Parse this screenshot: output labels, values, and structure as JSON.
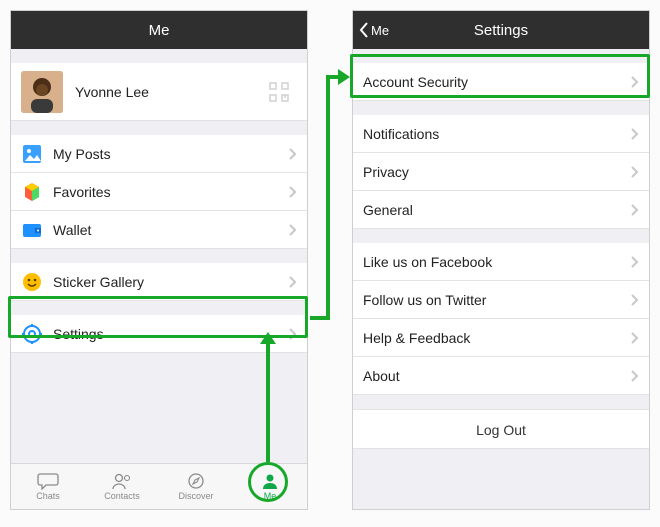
{
  "highlight_color": "#17a82a",
  "left": {
    "title": "Me",
    "profile": {
      "name": "Yvonne Lee"
    },
    "group1": [
      {
        "icon": "posts-icon",
        "label": "My Posts"
      },
      {
        "icon": "favorites-icon",
        "label": "Favorites"
      },
      {
        "icon": "wallet-icon",
        "label": "Wallet"
      }
    ],
    "group2": [
      {
        "icon": "sticker-icon",
        "label": "Sticker Gallery"
      }
    ],
    "group3": [
      {
        "icon": "settings-icon",
        "label": "Settings"
      }
    ],
    "tabs": [
      {
        "icon": "chat-icon",
        "label": "Chats",
        "active": false
      },
      {
        "icon": "contacts-icon",
        "label": "Contacts",
        "active": false
      },
      {
        "icon": "discover-icon",
        "label": "Discover",
        "active": false
      },
      {
        "icon": "me-tab-icon",
        "label": "Me",
        "active": true
      }
    ]
  },
  "right": {
    "back_label": "Me",
    "title": "Settings",
    "group1": [
      {
        "label": "Account Security"
      }
    ],
    "group2": [
      {
        "label": "Notifications"
      },
      {
        "label": "Privacy"
      },
      {
        "label": "General"
      }
    ],
    "group3": [
      {
        "label": "Like us on Facebook"
      },
      {
        "label": "Follow us on Twitter"
      },
      {
        "label": "Help & Feedback"
      },
      {
        "label": "About"
      }
    ],
    "logout_label": "Log Out"
  }
}
